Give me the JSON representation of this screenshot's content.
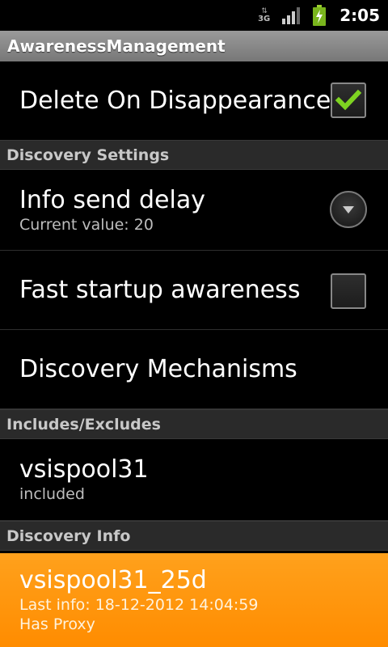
{
  "status_bar": {
    "network_type": "3G",
    "time": "2:05",
    "icons": [
      "network-3g-icon",
      "signal-strength-icon",
      "battery-charging-icon"
    ]
  },
  "app": {
    "title": "AwarenessManagement"
  },
  "preferences": {
    "delete_on_disappearance": {
      "title": "Delete On Disappearance",
      "checked": true
    },
    "discovery_settings_header": "Discovery Settings",
    "info_send_delay": {
      "title": "Info send delay",
      "summary": "Current value: 20"
    },
    "fast_startup_awareness": {
      "title": "Fast startup awareness",
      "checked": false
    },
    "discovery_mechanisms": {
      "title": "Discovery Mechanisms"
    },
    "includes_excludes_header": "Includes/Excludes",
    "include_item": {
      "title": "vsispool31",
      "summary": "included"
    },
    "discovery_info_header": "Discovery Info",
    "discovery_info_item": {
      "title": "vsispool31_25d",
      "last_info": "Last info: 18-12-2012 14:04:59",
      "proxy": "Has Proxy"
    }
  },
  "colors": {
    "accent_selected": "#ff8c00",
    "checkmark": "#7ed321",
    "header_bg": "#2a2a2a",
    "titlebar_bg": "#8a8a8a"
  }
}
